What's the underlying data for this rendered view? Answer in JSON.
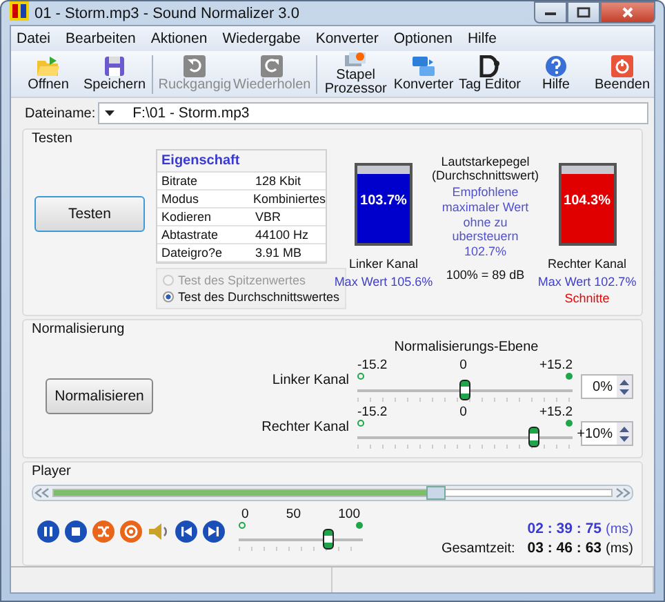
{
  "window": {
    "title": "01 - Storm.mp3 - Sound Normalizer 3.0"
  },
  "menu": [
    "Datei",
    "Bearbeiten",
    "Aktionen",
    "Wiedergabe",
    "Konverter",
    "Optionen",
    "Hilfe"
  ],
  "toolbar": [
    {
      "kind": "open",
      "label": "Offnen",
      "disabled": false
    },
    {
      "kind": "save",
      "label": "Speichern",
      "disabled": false
    },
    {
      "kind": "undo",
      "label": "Ruckgangig",
      "disabled": true
    },
    {
      "kind": "redo",
      "label": "Wiederholen",
      "disabled": true
    },
    {
      "kind": "batch",
      "label": "Stapel Prozessor",
      "disabled": false
    },
    {
      "kind": "convert",
      "label": "Konverter",
      "disabled": false
    },
    {
      "kind": "tag",
      "label": "Tag Editor",
      "disabled": false
    },
    {
      "kind": "help",
      "label": "Hilfe",
      "disabled": false
    },
    {
      "kind": "exit",
      "label": "Beenden",
      "disabled": false
    }
  ],
  "file": {
    "label": "Dateiname:",
    "value": "F:\\01 - Storm.mp3"
  },
  "testing": {
    "title": "Testen",
    "button": "Testen",
    "properties": {
      "header": "Eigenschaft",
      "rows": [
        {
          "name": "Bitrate",
          "value": "128 Kbit"
        },
        {
          "name": "Modus",
          "value": "Kombiniertes"
        },
        {
          "name": "Kodieren",
          "value": "VBR"
        },
        {
          "name": "Abtastrate",
          "value": "44100 Hz"
        },
        {
          "name": "Dateigro?e",
          "value": "3.91 MB"
        }
      ]
    },
    "modes": [
      {
        "label": "Test des Spitzenwertes",
        "selected": false,
        "disabled": true
      },
      {
        "label": "Test des Durchschnittswertes",
        "selected": true,
        "disabled": false
      }
    ],
    "heading": [
      "Lautstarkepegel",
      "(Durchschnittswert)"
    ],
    "recommendation": "Empfohlene maximaler Wert ohne zu ubersteuern 102.7%",
    "scale": "100% = 89 dB",
    "meters": [
      {
        "label": "Linker Kanal",
        "reading": "103.7%",
        "level": 0.9,
        "color": "#0000cc",
        "max": "Max Wert 105.6%"
      },
      {
        "label": "Rechter Kanal",
        "reading": "104.3%",
        "level": 0.9,
        "color": "#e00000",
        "max": "Max Wert 102.7%",
        "warning": "Schnitte"
      }
    ]
  },
  "normalization": {
    "title": "Normalisierung",
    "button": "Normalisieren",
    "heading": "Normalisierungs-Ebene",
    "channels": [
      {
        "label": "Linker Kanal",
        "min": "-15.2",
        "mid": "0",
        "max": "+15.2",
        "level": 0.5,
        "value": "0%"
      },
      {
        "label": "Rechter Kanal",
        "min": "-15.2",
        "mid": "0",
        "max": "+15.2",
        "level": 0.82,
        "value": "+10%"
      }
    ]
  },
  "player": {
    "title": "Player",
    "position": {
      "level": 0.67
    },
    "volume": {
      "ticks": [
        "0",
        "50",
        "100"
      ],
      "level": 0.72
    },
    "elapsed": "02 : 39 : 75",
    "elapsed_unit": "(ms)",
    "total_label": "Gesamtzeit:",
    "total": "03 : 46 : 63",
    "total_unit": "(ms)"
  }
}
